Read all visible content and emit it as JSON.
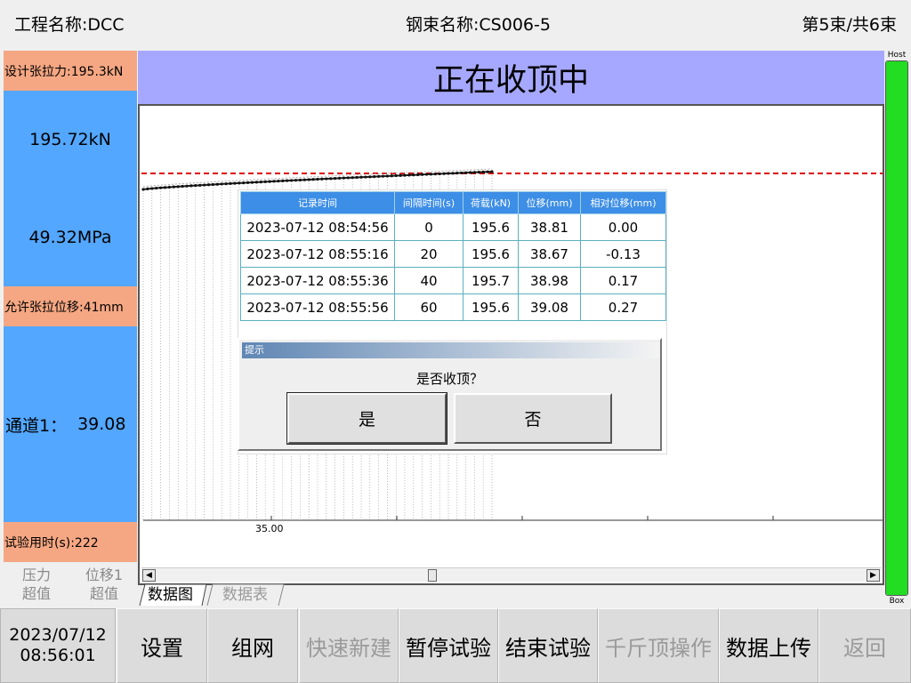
{
  "header": {
    "project": "工程名称:DCC",
    "strand": "钢束名称:CS006-5",
    "count": "第5束/共6束"
  },
  "left_panel": {
    "design_tension": "设计张拉力:195.3kN",
    "force": "195.72kN",
    "stress": "49.32MPa",
    "allowed_displacement": "允许张拉位移:41mm",
    "channel_label": "通道1：",
    "channel_value": "39.08",
    "elapsed": "试验用时(s):222",
    "alarm_pressure": "压力",
    "alarm_pressure_state": "超值",
    "alarm_disp": "位移1",
    "alarm_disp_state": "超值"
  },
  "status_banner": "正在收顶中",
  "gauge": {
    "top_label": "Host",
    "bottom_label": "Box",
    "level": 1.0,
    "color": "#22dd22"
  },
  "chart": {
    "x_tick": "35.00",
    "target_line_color": "#dd0000"
  },
  "table": {
    "headers": [
      "记录时间",
      "间隔时间(s)",
      "荷载(kN)",
      "位移(mm)",
      "相对位移(mm)"
    ],
    "rows": [
      [
        "2023-07-12 08:54:56",
        "0",
        "195.6",
        "38.81",
        "0.00"
      ],
      [
        "2023-07-12 08:55:16",
        "20",
        "195.6",
        "38.67",
        "-0.13"
      ],
      [
        "2023-07-12 08:55:36",
        "40",
        "195.7",
        "38.98",
        "0.17"
      ],
      [
        "2023-07-12 08:55:56",
        "60",
        "195.6",
        "39.08",
        "0.27"
      ]
    ]
  },
  "dialog": {
    "title": "提示",
    "message": "是否收顶？",
    "yes": "是",
    "no": "否"
  },
  "tabs": [
    "数据图",
    "数据表"
  ],
  "footer": {
    "date": "2023/07/12",
    "time": "08:56:01",
    "buttons": [
      "设置",
      "组网",
      "快速新建",
      "暂停试验",
      "结束试验",
      "千斤顶操作",
      "数据上传",
      "返回"
    ]
  },
  "colors": {
    "orange": "#f5a783",
    "blue": "#53a7ff",
    "banner": "#a6a8ff",
    "table_header": "#3d8ee6"
  }
}
